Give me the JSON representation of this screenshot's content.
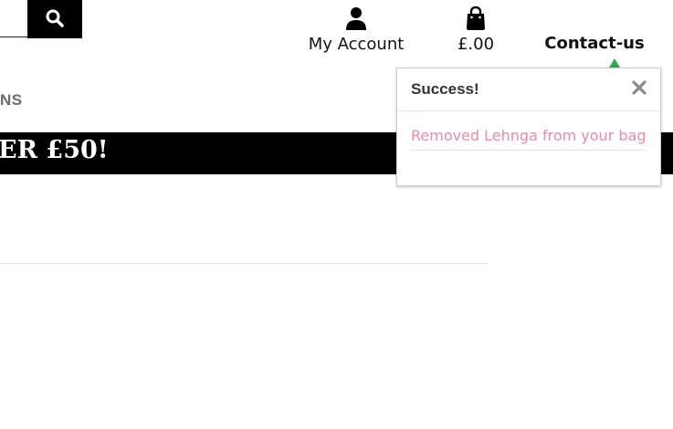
{
  "search": {
    "placeholder": "",
    "icon": "search-icon"
  },
  "header": {
    "account_label": "My Account",
    "account_icon": "user-icon",
    "bag_total": "£.00",
    "bag_icon": "shopping-bag-icon",
    "contact_label": "Contact-us"
  },
  "category": {
    "label_fragment": "NS"
  },
  "promo": {
    "text": "ER £50!"
  },
  "toast": {
    "title": "Success!",
    "message": "Removed Lehnga from your bag",
    "close_icon": "close-icon",
    "status_color": "#2eaa4a",
    "message_color": "#e88aa8"
  }
}
